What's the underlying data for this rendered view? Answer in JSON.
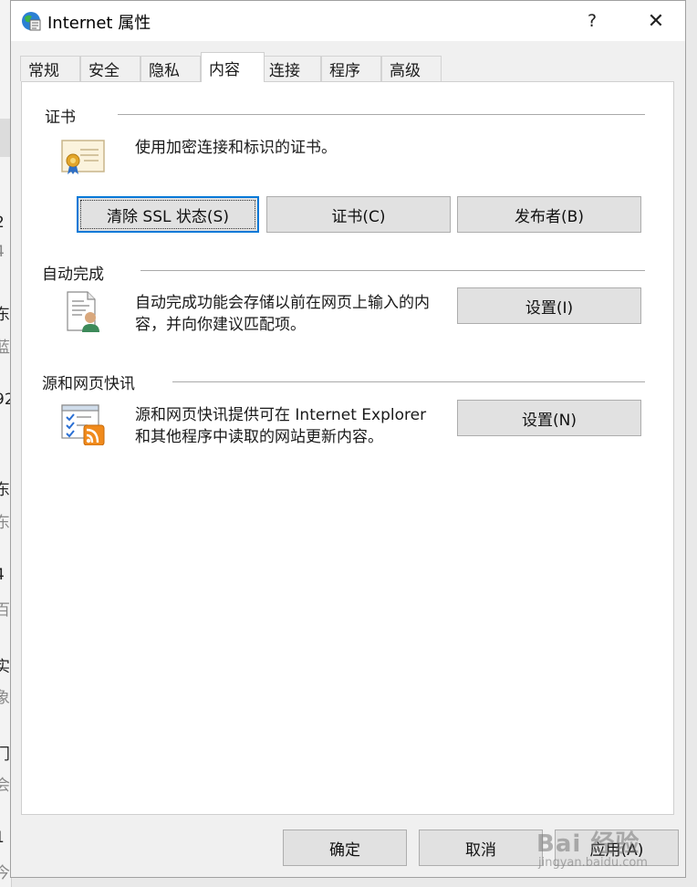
{
  "window": {
    "title": "Internet 属性",
    "help_glyph": "?",
    "close_glyph": "✕"
  },
  "tabs": [
    {
      "label": "常规"
    },
    {
      "label": "安全"
    },
    {
      "label": "隐私"
    },
    {
      "label": "内容",
      "active": true
    },
    {
      "label": "连接"
    },
    {
      "label": "程序"
    },
    {
      "label": "高级"
    }
  ],
  "certificates": {
    "title": "证书",
    "description": "使用加密连接和标识的证书。",
    "clear_ssl_label": "清除 SSL 状态(S)",
    "certificates_label": "证书(C)",
    "publishers_label": "发布者(B)"
  },
  "autocomplete": {
    "title": "自动完成",
    "description_line1": "自动完成功能会存储以前在网页上输入的内",
    "description_line2": "容，并向你建议匹配项。",
    "settings_label": "设置(I)"
  },
  "feeds": {
    "title": "源和网页快讯",
    "description_line1": "源和网页快讯提供可在 Internet Explorer",
    "description_line2": "和其他程序中读取的网站更新内容。",
    "settings_label": "设置(N)"
  },
  "footer": {
    "ok_label": "确定",
    "cancel_label": "取消",
    "apply_label": "应用(A)"
  },
  "watermark": {
    "main": "Bai 经验",
    "sub": "jingyan.baidu.com"
  },
  "background_fragments": [
    "2",
    "4",
    "东",
    "蓝",
    "92",
    "：",
    "东",
    "东",
    "4",
    "百",
    "实",
    "象",
    "门",
    "会",
    "1",
    "今"
  ]
}
